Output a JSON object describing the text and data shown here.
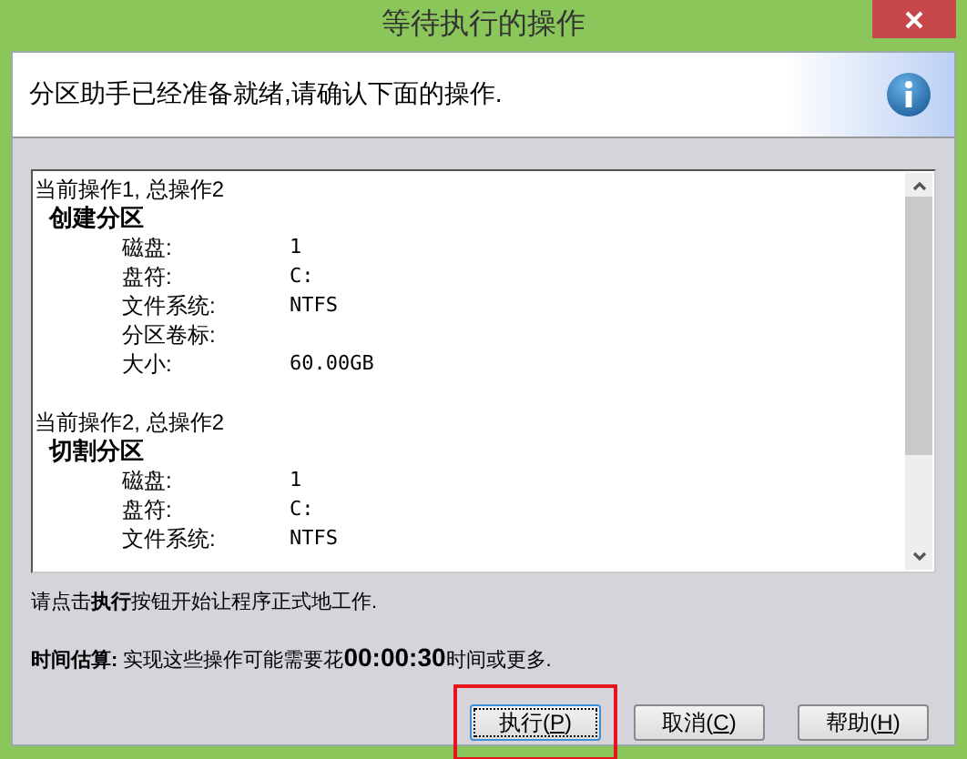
{
  "window": {
    "title": "等待执行的操作"
  },
  "header": {
    "message": "分区助手已经准备就绪,请确认下面的操作."
  },
  "operations": [
    {
      "header": "当前操作1, 总操作2",
      "title": "创建分区",
      "fields": [
        {
          "label": "磁盘:",
          "value": "1"
        },
        {
          "label": "盘符:",
          "value": "C:"
        },
        {
          "label": "文件系统:",
          "value": "NTFS"
        },
        {
          "label": "分区卷标:"
        },
        {
          "label": "大小:",
          "value": "60.00GB"
        }
      ]
    },
    {
      "header": "当前操作2, 总操作2",
      "title": "切割分区",
      "fields": [
        {
          "label": "磁盘:",
          "value": "1"
        },
        {
          "label": "盘符:",
          "value": "C:"
        },
        {
          "label": "文件系统:",
          "value": "NTFS"
        }
      ]
    }
  ],
  "instruction": "请点击**执行**按钮开始让程序正式地工作.",
  "estimate": "**时间估算:** 实现这些操作可能需要花**00:00:30**时间或更多.",
  "buttons": [
    {
      "prefix": "执行(",
      "key": "P",
      "suffix": ")",
      "highlighted": true
    },
    {
      "prefix": "取消(",
      "key": "C",
      "suffix": ")",
      "highlighted": false
    },
    {
      "prefix": "帮助(",
      "key": "H",
      "suffix": ")",
      "highlighted": false
    }
  ]
}
